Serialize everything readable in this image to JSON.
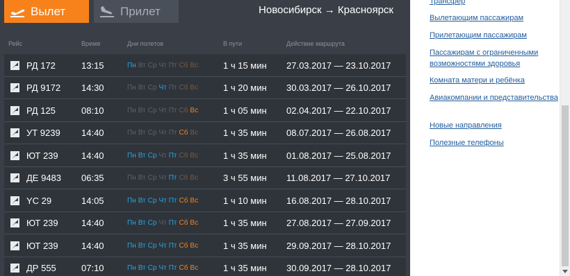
{
  "tabs": {
    "departure": "Вылет",
    "arrival": "Прилет"
  },
  "route": "Новосибирск → Красноярск",
  "columns": {
    "flight": "Рейс",
    "time": "Время",
    "days": "Дни полетов",
    "duration": "В пути",
    "period": "Действие маршрута"
  },
  "weekdays": [
    "Пн",
    "Вт",
    "Ср",
    "Чт",
    "Пт",
    "Сб",
    "Вс"
  ],
  "flights": [
    {
      "icon": "airline-logo-icon",
      "flight": "РД 172",
      "time": "13:15",
      "days": [
        1,
        0,
        0,
        0,
        0,
        0,
        0
      ],
      "duration": "1 ч 15 мин",
      "period": "27.03.2017 — 23.10.2017"
    },
    {
      "icon": "airline-logo-icon",
      "flight": "РД 9172",
      "time": "14:30",
      "days": [
        0,
        0,
        0,
        1,
        0,
        0,
        0
      ],
      "duration": "1 ч 20 мин",
      "period": "30.03.2017 — 26.10.2017"
    },
    {
      "icon": "airline-logo-icon",
      "flight": "РД 125",
      "time": "08:10",
      "days": [
        0,
        0,
        0,
        0,
        0,
        0,
        1
      ],
      "duration": "1 ч 05 мин",
      "period": "02.04.2017 — 22.10.2017"
    },
    {
      "icon": "airline-logo-icon",
      "flight": "УТ 9239",
      "time": "14:40",
      "days": [
        0,
        0,
        0,
        0,
        0,
        1,
        0
      ],
      "duration": "1 ч 35 мин",
      "period": "08.07.2017 — 26.08.2017"
    },
    {
      "icon": "airline-logo-icon",
      "flight": "ЮТ 239",
      "time": "14:40",
      "days": [
        1,
        1,
        1,
        0,
        1,
        0,
        0
      ],
      "duration": "1 ч 35 мин",
      "period": "01.08.2017 — 25.08.2017"
    },
    {
      "icon": "airline-logo-icon",
      "flight": "ДЕ 9483",
      "time": "06:35",
      "days": [
        0,
        0,
        0,
        0,
        1,
        0,
        0
      ],
      "duration": "3 ч 55 мин",
      "period": "11.08.2017 — 27.10.2017"
    },
    {
      "icon": "airline-logo-icon",
      "flight": "YC 29",
      "time": "14:05",
      "days": [
        1,
        1,
        1,
        1,
        1,
        1,
        1
      ],
      "duration": "1 ч 10 мин",
      "period": "16.08.2017 — 28.10.2017"
    },
    {
      "icon": "airline-logo-icon",
      "flight": "ЮТ 239",
      "time": "14:40",
      "days": [
        1,
        1,
        1,
        0,
        1,
        1,
        1
      ],
      "duration": "1 ч 35 мин",
      "period": "27.08.2017 — 27.09.2017"
    },
    {
      "icon": "airline-logo-icon",
      "flight": "ЮТ 239",
      "time": "14:40",
      "days": [
        1,
        1,
        1,
        1,
        1,
        1,
        1
      ],
      "duration": "1 ч 35 мин",
      "period": "29.09.2017 — 28.10.2017"
    },
    {
      "icon": "airline-logo-icon",
      "flight": "ДР 555",
      "time": "07:10",
      "days": [
        1,
        1,
        1,
        1,
        1,
        1,
        1
      ],
      "duration": "1 ч 35 мин",
      "period": "30.09.2017 — 28.10.2017"
    }
  ],
  "sidebar": {
    "links": [
      "Трансфер",
      "Вылетающим пассажирам",
      "Прилетающим пассажирам",
      "Пассажирам с ограниченными возможностями здоровья",
      "Комната матери и ребёнка",
      "Авиакомпании и представительства",
      "Новые направления",
      "Полезные телефоны"
    ]
  },
  "colors": {
    "accent": "#f7821b",
    "day_active": "#27a6df",
    "link": "#1f5b9c",
    "panel": "#3a3f47"
  }
}
